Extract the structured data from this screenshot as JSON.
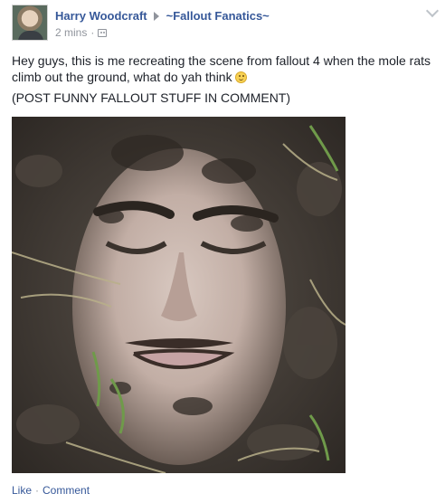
{
  "post": {
    "author": "Harry Woodcraft",
    "group": "~Fallout Fanatics~",
    "timestamp": "2 mins",
    "meta_separator": "·",
    "body_line1": "Hey guys, this is me recreating the scene from fallout 4 when the mole rats climb out the ground, what do yah think",
    "body_line2": "(POST FUNNY FALLOUT STUFF IN COMMENT)",
    "icons": {
      "audience": "friends-audience-icon",
      "options": "chevron-down-icon",
      "emoji": "smiley-icon",
      "group_arrow": "triangle-right-icon"
    }
  },
  "actions": {
    "like_label": "Like",
    "separator": "·",
    "comment_label": "Comment"
  },
  "colors": {
    "link": "#365899",
    "meta": "#90949c",
    "text": "#1d2129",
    "background": "#ffffff"
  }
}
